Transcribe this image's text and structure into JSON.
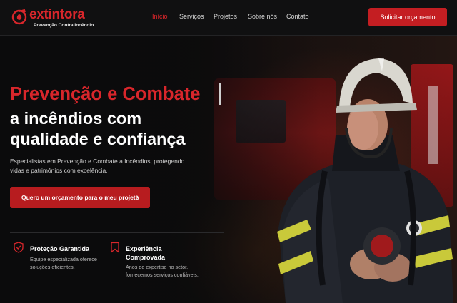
{
  "brand": {
    "name": "extintora",
    "tagline": "Prevenção Contra Incêndio",
    "accent_color": "#d8262b"
  },
  "nav": {
    "items": [
      {
        "label": "Início",
        "active": true
      },
      {
        "label": "Serviços",
        "active": false
      },
      {
        "label": "Projetos",
        "active": false
      },
      {
        "label": "Sobre nós",
        "active": false
      },
      {
        "label": "Contato",
        "active": false
      }
    ],
    "cta_label": "Solicitar orçamento"
  },
  "hero": {
    "title_highlight": "Prevenção e Combate",
    "title_line2": "a incêndios com",
    "title_line3": "qualidade e confiança",
    "subtitle": "Especialistas em Prevenção e Combate a Incêndios, protegendo vidas e patrimônios com excelência.",
    "cta_label": "Quero um orçamento para o meu projeto",
    "cta_arrow": "›"
  },
  "features": [
    {
      "icon": "shield-check-icon",
      "title": "Proteção Garantida",
      "desc_line1": "Equipe especializada oferece",
      "desc_line2": "soluções eficientes."
    },
    {
      "icon": "bookmark-icon",
      "title_line1": "Experiência",
      "title_line2": "Comprovada",
      "desc_line1": "Anos de expertise no setor,",
      "desc_line2": "fornecemos serviços confiáveis."
    }
  ]
}
